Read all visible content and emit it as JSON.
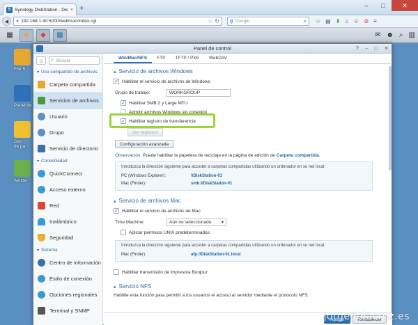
{
  "browser": {
    "tab_title": "Synology DiskStation - DiskSt...",
    "tab_close": "×",
    "new_tab": "+",
    "url": "192.168.1.40:5000/webman/index.cgi",
    "search_placeholder": "Google",
    "min_btn": "–",
    "max_btn": "□",
    "close_btn": "✕"
  },
  "desktop": {
    "icons": [
      {
        "label": "File S"
      },
      {
        "label": "Panel de"
      },
      {
        "label": "Cen\nde pa"
      },
      {
        "label": "Ayuda"
      }
    ]
  },
  "window": {
    "title": "Panel de control",
    "controls": [
      "?",
      "–",
      "□",
      "✕"
    ]
  },
  "sidebar": {
    "search_placeholder": "Buscar",
    "section1": "Uso compartido de archivos",
    "items1": [
      {
        "label": "Carpeta compartida",
        "color": "#e8a830"
      },
      {
        "label": "Servicios de archivos",
        "color": "#4a9a3a"
      },
      {
        "label": "Usuario",
        "color": "#5b8fcf"
      },
      {
        "label": "Grupo",
        "color": "#5b8fcf"
      },
      {
        "label": "Servicio de directorio",
        "color": "#3a6fb0"
      }
    ],
    "section2": "Conectividad",
    "items2": [
      {
        "label": "QuickConnect",
        "color": "#3a9ad9"
      },
      {
        "label": "Acceso externo",
        "color": "#3a9ad9"
      },
      {
        "label": "Red",
        "color": "#d9473a"
      },
      {
        "label": "Inalámbrico",
        "color": "#3a9ad9"
      },
      {
        "label": "Seguridad",
        "color": "#e8b030"
      }
    ],
    "section3": "Sistema",
    "items3": [
      {
        "label": "Centro de información",
        "color": "#3a6fb0"
      },
      {
        "label": "Estilo de conexión",
        "color": "#3a9ad9"
      },
      {
        "label": "Opciones regionales",
        "color": "#3a9ad9"
      },
      {
        "label": "Terminal y SNMP",
        "color": "#555555"
      }
    ]
  },
  "tabs": [
    "Win/Mac/NFS",
    "FTP",
    "TFTP / PXE",
    "WebDAV"
  ],
  "windows_section": {
    "title": "Servicio de archivos Windows",
    "enable": "Habilitar el servicio de archivos de Windows",
    "workgroup_label": "Grupo de trabajo:",
    "workgroup_value": "WORKGROUP",
    "smb2": "Habilitar SMB 2 y Large MTU",
    "offline": "Admitir archivos Windows sin conexión",
    "transfer_log": "Habilitar registro de transferencia",
    "view_logs": "Ver registros",
    "advanced": "Configuración avanzada",
    "note_label": "Observación:",
    "note_text": " Puede habilitar la papelera de reciclaje en la página de edición de ",
    "note_link": "Carpeta compartida",
    "note_end": ".",
    "info_intro": "Introduzca la dirección siguiente para acceder a carpetas compartidas utilizando un ordenador en su red local:",
    "pc_label": "PC (Windows Explorer):",
    "pc_value": "\\\\DiskStation-01",
    "mac_label": "Mac (Finder):",
    "mac_value": "smb://DiskStation-01"
  },
  "mac_section": {
    "title": "Servicio de archivos Mac",
    "enable": "Habilitar el servicio de archivos de Mac",
    "tm_label": "Time Machine:",
    "tm_value": "Aún no seleccionado",
    "unix": "Aplicar permisos UNIX predeterminados",
    "info_intro": "Introduzca la dirección siguiente para acceder a carpetas compartidas utilizando un ordenador en su red local:",
    "mac_label": "Mac (Finder):",
    "mac_value": "afp://DiskStation-01.local"
  },
  "bonjour": "Habilitar transmisión de impresora Bonjour",
  "nfs_section": {
    "title": "Servicio NFS",
    "desc": "Habilite esta función para permitir a los usuarios el acceso al servidor mediante el protocolo NFS."
  },
  "footer": {
    "apply": "Aplicar",
    "cancel": "Restablecer"
  },
  "watermark": "jorgedelacruz.es"
}
